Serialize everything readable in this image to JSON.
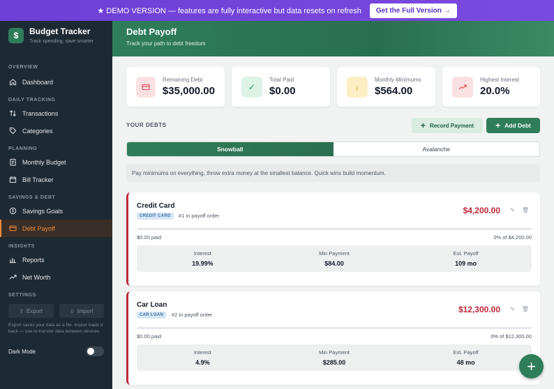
{
  "banner": {
    "text": "★ DEMO VERSION — features are fully interactive but data resets on refresh",
    "cta": "Get the Full Version →"
  },
  "sidebar": {
    "brand_title": "Budget Tracker",
    "brand_subtitle": "Track spending, save smarter",
    "brand_icon": "$",
    "sections": {
      "overview": "OVERVIEW",
      "daily": "DAILY TRACKING",
      "planning": "PLANNING",
      "savings": "SAVINGS & DEBT",
      "insights": "INSIGHTS",
      "settings": "SETTINGS"
    },
    "items": {
      "dashboard": "Dashboard",
      "transactions": "Transactions",
      "categories": "Categories",
      "monthly_budget": "Monthly Budget",
      "bill_tracker": "Bill Tracker",
      "savings_goals": "Savings Goals",
      "debt_payoff": "Debt Payoff",
      "reports": "Reports",
      "net_worth": "Net Worth"
    },
    "export_label": "Export",
    "import_label": "Import",
    "note": "Export saves your data as a file. Import loads it back — use to transfer data between devices.",
    "dark_mode_label": "Dark Mode"
  },
  "header": {
    "title": "Debt Payoff",
    "subtitle": "Track your path to debt freedom"
  },
  "stats": {
    "remaining": {
      "label": "Remaining Debt",
      "value": "$35,000.00"
    },
    "total_paid": {
      "label": "Total Paid",
      "value": "$0.00"
    },
    "minimums": {
      "label": "Monthly Minimums",
      "value": "$564.00"
    },
    "highest": {
      "label": "Highest Interest",
      "value": "20.0%"
    }
  },
  "debts_section": {
    "title": "YOUR DEBTS",
    "record_label": "Record Payment",
    "add_label": "Add Debt"
  },
  "tabs": {
    "snowball": "Snowball",
    "avalanche": "Avalanche"
  },
  "strategy_description": "Pay minimums on everything, throw extra money at the smallest balance. Quick wins build momentum.",
  "debts": [
    {
      "name": "Credit Card",
      "badge": "CREDIT CARD",
      "order": "#1 in payoff order",
      "amount": "$4,200.00",
      "paid": "$0.00 paid",
      "pct": "0% of $4,200.00",
      "progress": 0,
      "interest_label": "Interest",
      "interest": "19.99%",
      "min_label": "Min Payment",
      "min": "$84.00",
      "payoff_label": "Est. Payoff",
      "payoff": "109 mo"
    },
    {
      "name": "Car Loan",
      "badge": "CAR LOAN",
      "order": "#2 in payoff order",
      "amount": "$12,300.00",
      "paid": "$0.00 paid",
      "pct": "0% of $12,300.00",
      "progress": 0,
      "interest_label": "Interest",
      "interest": "4.9%",
      "min_label": "Min Payment",
      "min": "$285.00",
      "payoff_label": "Est. Payoff",
      "payoff": "48 mo"
    }
  ],
  "colors": {
    "accent": "#2f7d5a",
    "debt_red": "#c0283a",
    "active_nav": "#f08a3a",
    "banner": "#6d3fd6"
  }
}
